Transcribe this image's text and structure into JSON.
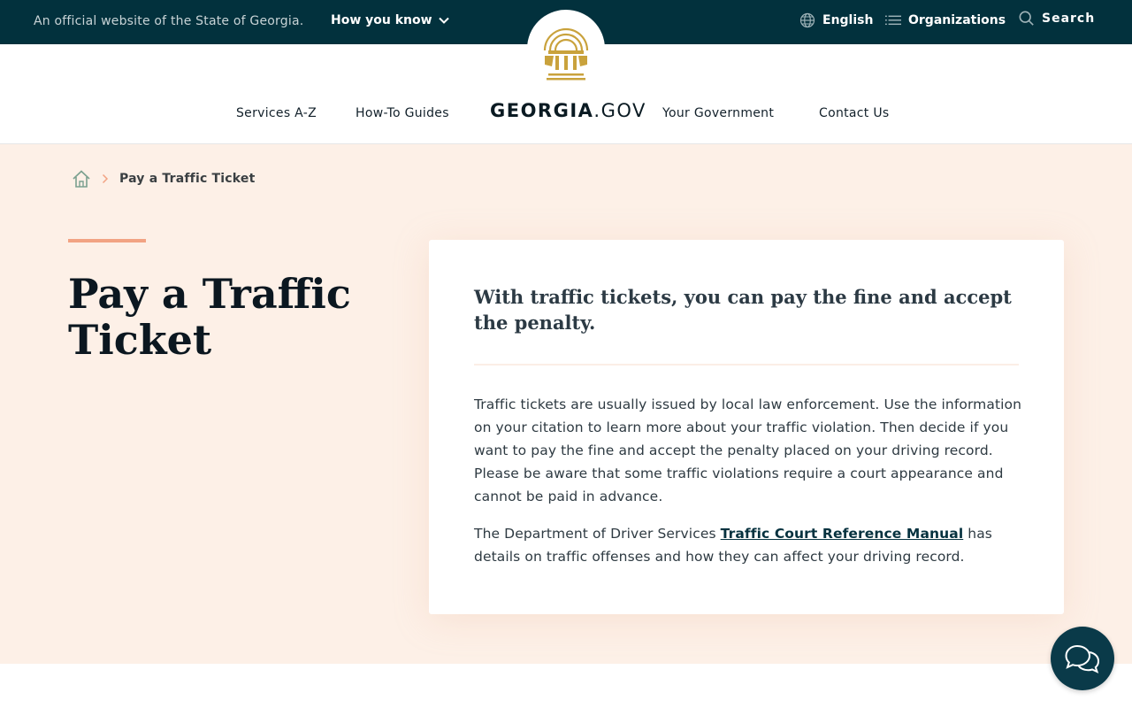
{
  "topbar": {
    "official_text": "An official website of the State of Georgia.",
    "how_you_know": "How you know",
    "language": "English",
    "organizations": "Organizations",
    "search": "Search"
  },
  "nav": {
    "services": "Services A-Z",
    "guides": "How-To Guides",
    "brand_bold": "GEORGIA",
    "brand_rest": ".GOV",
    "government": "Your Government",
    "contact": "Contact Us"
  },
  "breadcrumb": {
    "current": "Pay a Traffic Ticket"
  },
  "page": {
    "title": "Pay a Traffic Ticket",
    "lead": "With traffic tickets, you can pay the fine and accept the penalty.",
    "paragraph1": "Traffic tickets are usually issued by local law enforcement. Use the information on your citation to learn more about your traffic violation. Then decide if you want to pay the fine and accept the penalty placed on your driving record. Please be aware that some traffic violations require a court appearance and cannot be paid in advance.",
    "paragraph2_before": "The Department of Driver Services ",
    "paragraph2_link": "Traffic Court Reference Manual",
    "paragraph2_after": " has details on traffic offenses and how they can affect your driving record."
  },
  "icons": {
    "globe": "globe-icon",
    "list": "list-icon",
    "search": "search-icon",
    "chevron": "chevron-down-icon",
    "home": "home-icon",
    "chat": "chat-icon",
    "seal": "georgia-seal-logo"
  },
  "colors": {
    "topbar_bg": "#02313d",
    "hero_bg": "#fdf0e7",
    "accent": "#f2a383",
    "seal_gold": "#c9a23c",
    "chat_bg": "#0a3a49"
  }
}
